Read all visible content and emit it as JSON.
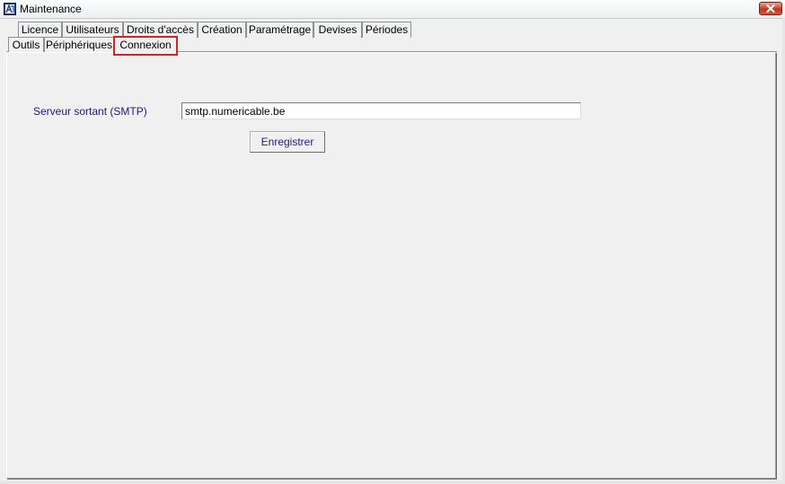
{
  "window": {
    "title": "Maintenance",
    "icon": "app-icon",
    "close_icon": "close-icon"
  },
  "tabs_row1": [
    {
      "label": "Licence"
    },
    {
      "label": "Utilisateurs"
    },
    {
      "label": "Droits d'accès"
    },
    {
      "label": "Création"
    },
    {
      "label": "Paramétrage"
    },
    {
      "label": "Devises"
    },
    {
      "label": "Périodes"
    }
  ],
  "tabs_row2": [
    {
      "label": "Outils"
    },
    {
      "label": "Périphériques"
    },
    {
      "label": "Connexion",
      "active": true
    }
  ],
  "form": {
    "smtp_label": "Serveur sortant (SMTP)",
    "smtp_value": "smtp.numericable.be",
    "save_label": "Enregistrer"
  },
  "colors": {
    "label_text": "#1b1b7a",
    "active_tab_highlight": "#d92121"
  }
}
